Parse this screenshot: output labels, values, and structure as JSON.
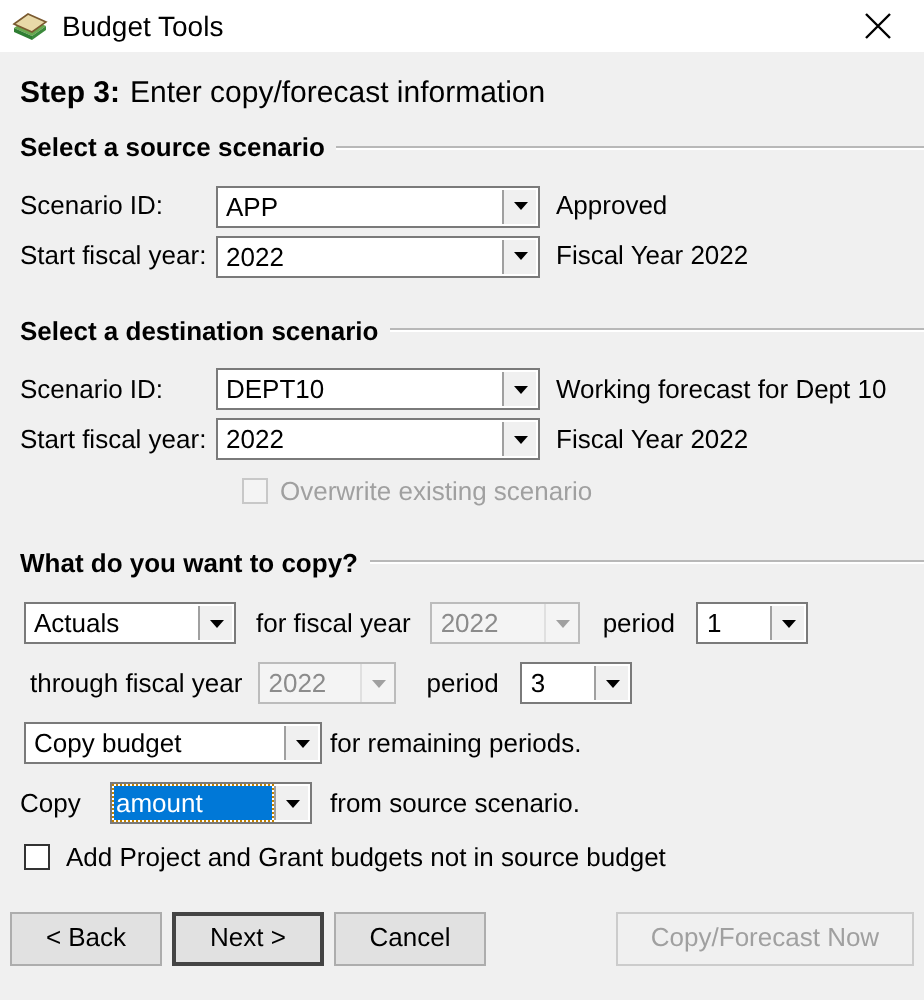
{
  "window": {
    "title": "Budget Tools"
  },
  "step": {
    "label": "Step 3:",
    "text": "Enter copy/forecast information"
  },
  "source": {
    "heading": "Select a source scenario",
    "fields": [
      {
        "label": "Scenario ID:",
        "value": "APP",
        "description": "Approved"
      },
      {
        "label": "Start fiscal year:",
        "value": "2022",
        "description": "Fiscal Year 2022"
      }
    ]
  },
  "destination": {
    "heading": "Select a destination scenario",
    "fields": [
      {
        "label": "Scenario ID:",
        "value": "DEPT10",
        "description": "Working forecast for Dept 10"
      },
      {
        "label": "Start fiscal year:",
        "value": "2022",
        "description": "Fiscal Year 2022"
      }
    ],
    "overwrite": {
      "label": "Overwrite existing scenario",
      "checked": false,
      "disabled": true
    }
  },
  "copy": {
    "heading": "What do you want to copy?",
    "what": {
      "value": "Actuals",
      "disabled": false
    },
    "for_label": "for fiscal year",
    "from_year": {
      "value": "2022",
      "disabled": true
    },
    "from_period_label": "period",
    "from_period": {
      "value": "1",
      "disabled": false
    },
    "through_label": "through fiscal year",
    "to_year": {
      "value": "2022",
      "disabled": true
    },
    "to_period_label": "period",
    "to_period": {
      "value": "3",
      "disabled": false
    },
    "remaining": {
      "value": "Copy budget",
      "disabled": false
    },
    "remaining_label": "for remaining periods.",
    "copy_label": "Copy",
    "amount": {
      "value": "amount",
      "disabled": false,
      "focused": true
    },
    "from_label": "from source scenario.",
    "add_budgets": {
      "label": "Add Project and Grant budgets not in source budget",
      "checked": false,
      "disabled": false
    }
  },
  "buttons": [
    {
      "label": "< Back",
      "disabled": false,
      "default": false
    },
    {
      "label": "Next >",
      "disabled": false,
      "default": true
    },
    {
      "label": "Cancel",
      "disabled": false,
      "default": false
    },
    {
      "label": "Copy/Forecast Now",
      "disabled": true,
      "default": false
    }
  ]
}
